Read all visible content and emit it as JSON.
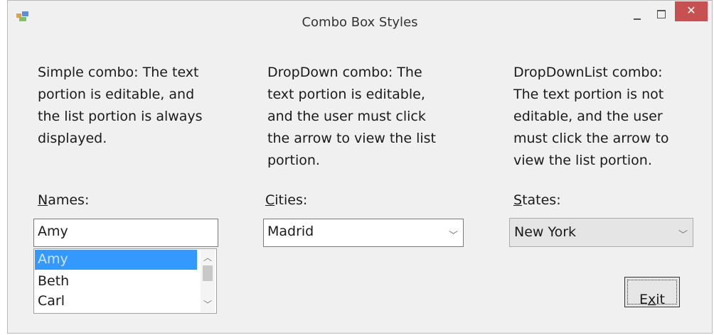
{
  "window": {
    "title": "Combo Box Styles",
    "close_glyph": "✕"
  },
  "descriptions": {
    "simple": "Simple combo: The text portion is editable, and the list portion is always displayed.",
    "dropdown": "DropDown combo: The text portion is editable, and the user must click the arrow to view the list portion.",
    "dropdownlist": "DropDownList combo: The text portion is not editable, and the user must click the arrow to view the list portion."
  },
  "names": {
    "label_accel": "N",
    "label_rest": "ames:",
    "value": "Amy",
    "items": [
      "Amy",
      "Beth",
      "Carl"
    ],
    "selected_index": 0
  },
  "cities": {
    "label_accel": "C",
    "label_rest": "ities:",
    "value": "Madrid"
  },
  "states": {
    "label_accel": "S",
    "label_rest": "tates:",
    "value": "New York"
  },
  "exit_button": {
    "accel": "x",
    "before": "E",
    "after": "it"
  },
  "colors": {
    "selection": "#3399ff",
    "close_button": "#c75050",
    "window_bg": "#f0f0f0"
  }
}
